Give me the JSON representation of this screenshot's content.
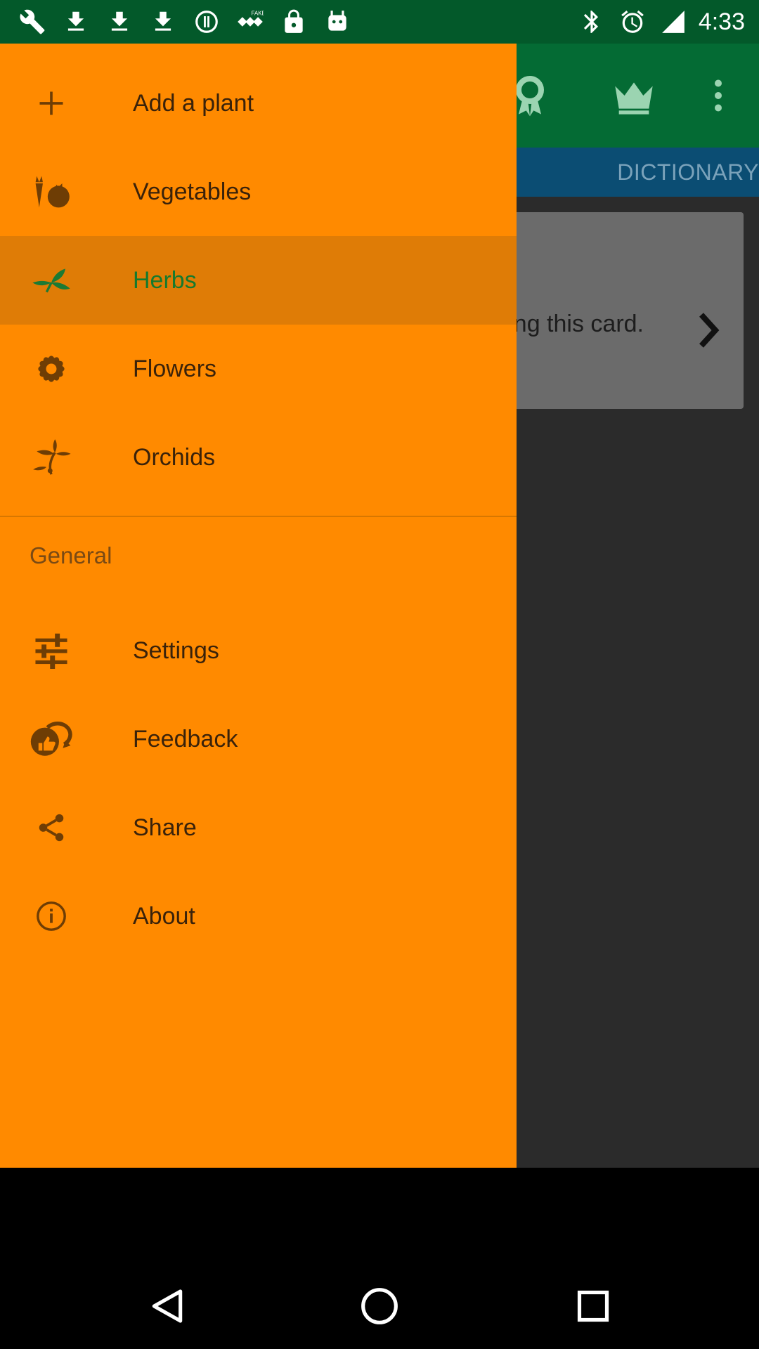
{
  "status_bar": {
    "time": "4:33",
    "left_icons": [
      "wrench-icon",
      "download-icon",
      "download-icon",
      "download-icon",
      "info-icon",
      "fake-gps-icon",
      "lock-icon",
      "android-icon"
    ],
    "right_icons": [
      "bluetooth-icon",
      "alarm-icon",
      "signal-icon"
    ]
  },
  "app": {
    "tab_dictionary": "DICTIONARY",
    "card_text": "ing this card.",
    "toolbar_icons": [
      "award-icon",
      "crown-icon",
      "more-vert-icon"
    ]
  },
  "drawer": {
    "items": [
      {
        "label": "Add a plant",
        "icon": "plus-icon"
      },
      {
        "label": "Vegetables",
        "icon": "vegetables-icon"
      },
      {
        "label": "Herbs",
        "icon": "herb-leaf-icon",
        "selected": true
      },
      {
        "label": "Flowers",
        "icon": "flower-icon"
      },
      {
        "label": "Orchids",
        "icon": "orchid-icon"
      }
    ],
    "section_title": "General",
    "general_items": [
      {
        "label": "Settings",
        "icon": "sliders-icon"
      },
      {
        "label": "Feedback",
        "icon": "feedback-icon"
      },
      {
        "label": "Share",
        "icon": "share-icon"
      },
      {
        "label": "About",
        "icon": "info-icon"
      }
    ]
  },
  "colors": {
    "drawer_bg": "#ff8a00",
    "selected_bg": "#df7c06",
    "selected_text": "#157a2e",
    "toolbar_green": "#046b34",
    "status_green": "#03592a",
    "tab_blue": "#0b4d73",
    "fab_green": "#074d1e"
  }
}
